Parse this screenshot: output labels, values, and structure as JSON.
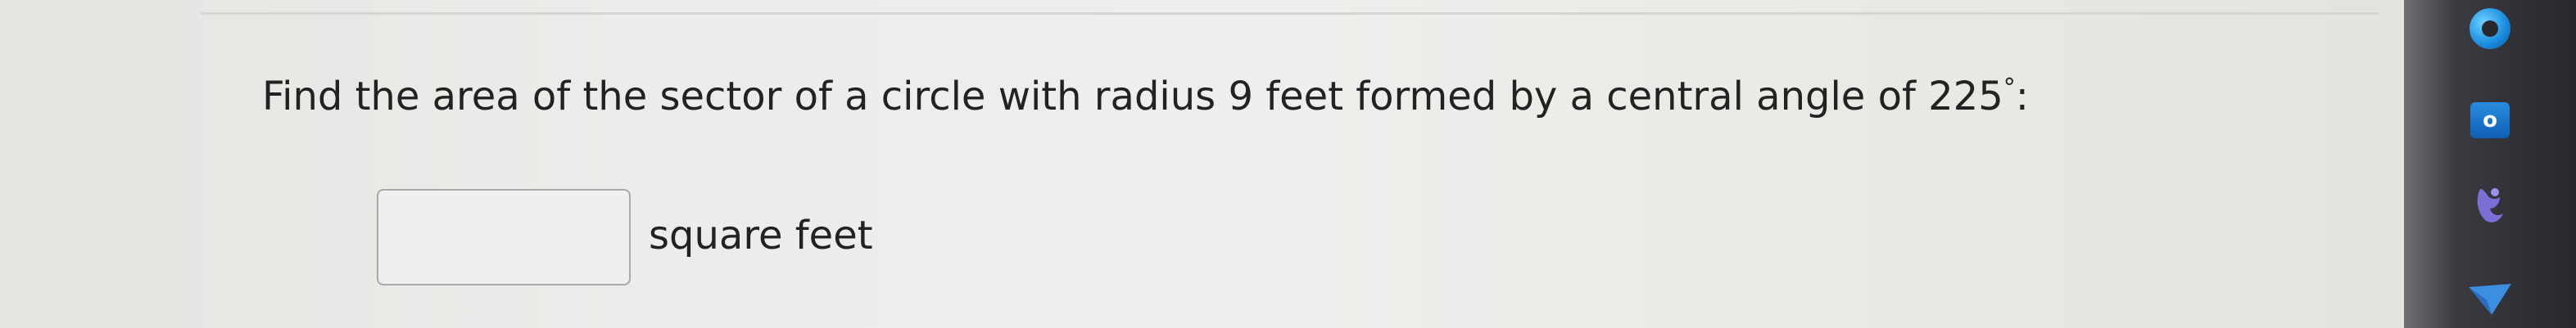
{
  "question": {
    "text": "Find the area of the sector of a circle with radius 9 feet formed by a central angle of 225",
    "degree_symbol": "°",
    "suffix": ":"
  },
  "answer": {
    "value": "",
    "units": "square feet"
  },
  "taskbar": {
    "icons": [
      "edge-icon",
      "outlook-icon",
      "teams-icon",
      "send-arrow-icon"
    ],
    "outlook_letter": "o"
  },
  "colors": {
    "text": "#222222",
    "input_border": "#a9a9a9",
    "taskbar": "#27282d",
    "edge_blue": "#1f8fe0",
    "outlook_blue": "#0f5fb3",
    "teams_purple": "#7b6fd6"
  }
}
